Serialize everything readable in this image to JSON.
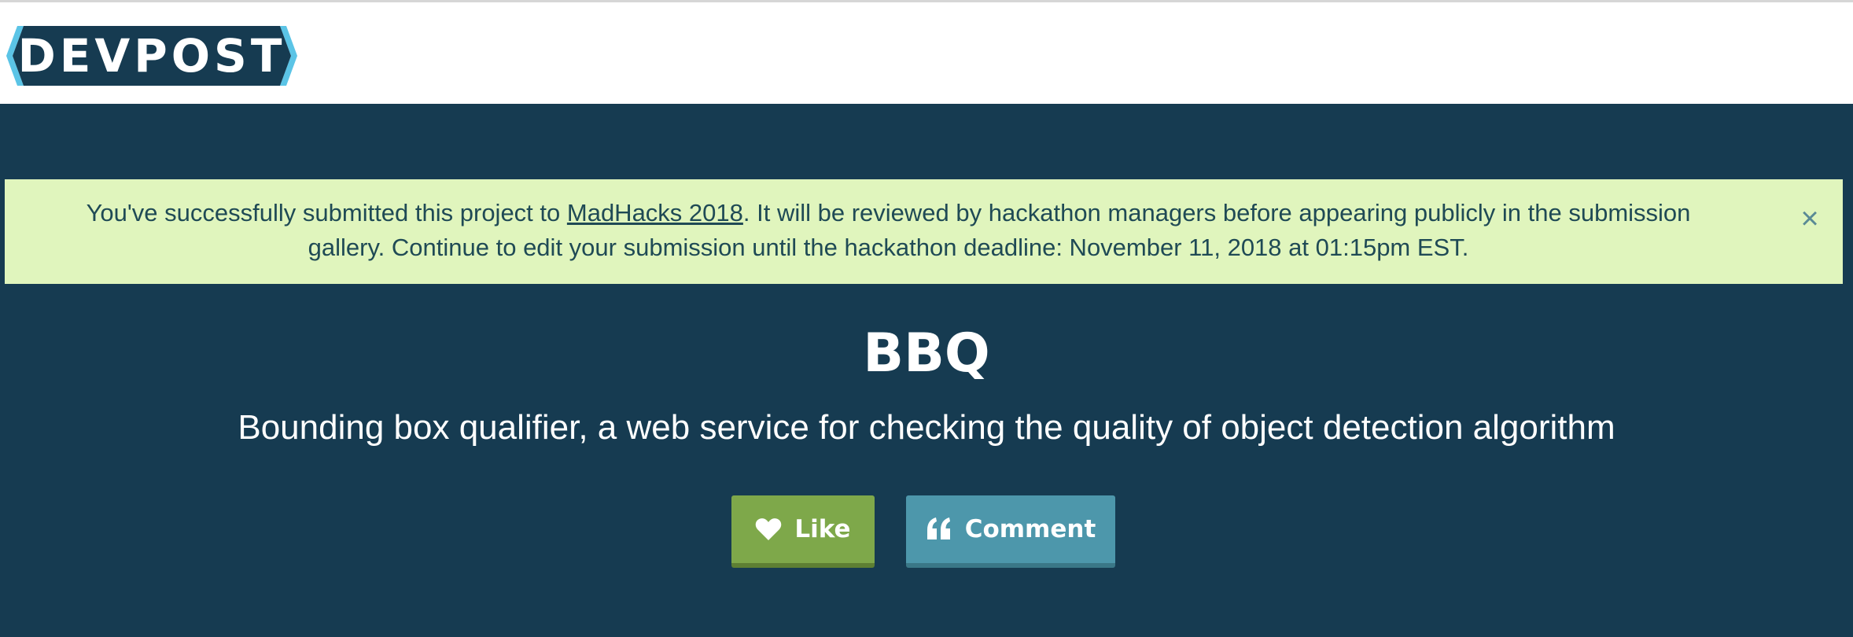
{
  "header": {
    "logo_text": "DEVPOST",
    "colors": {
      "logo_bg": "#163b51",
      "logo_accent": "#5bc4e6"
    }
  },
  "flash": {
    "text_before": "You've successfully submitted this project to ",
    "link_text": "MadHacks 2018",
    "text_after": ". It will be reviewed by hackathon managers before appearing publicly in the submission gallery. Continue to edit your submission until the hackathon deadline: November 11, 2018 at 01:15pm EST.",
    "close_symbol": "×",
    "close_icon": "close-icon",
    "background": "#e0f5bd"
  },
  "project": {
    "title": "BBQ",
    "tagline": "Bounding box qualifier, a web service for checking the quality of object detection algorithm"
  },
  "actions": {
    "like_label": "Like",
    "like_icon": "heart-icon",
    "like_color": "#7ea84a",
    "comment_label": "Comment",
    "comment_icon": "quote-icon",
    "comment_color": "#4d97ab"
  }
}
